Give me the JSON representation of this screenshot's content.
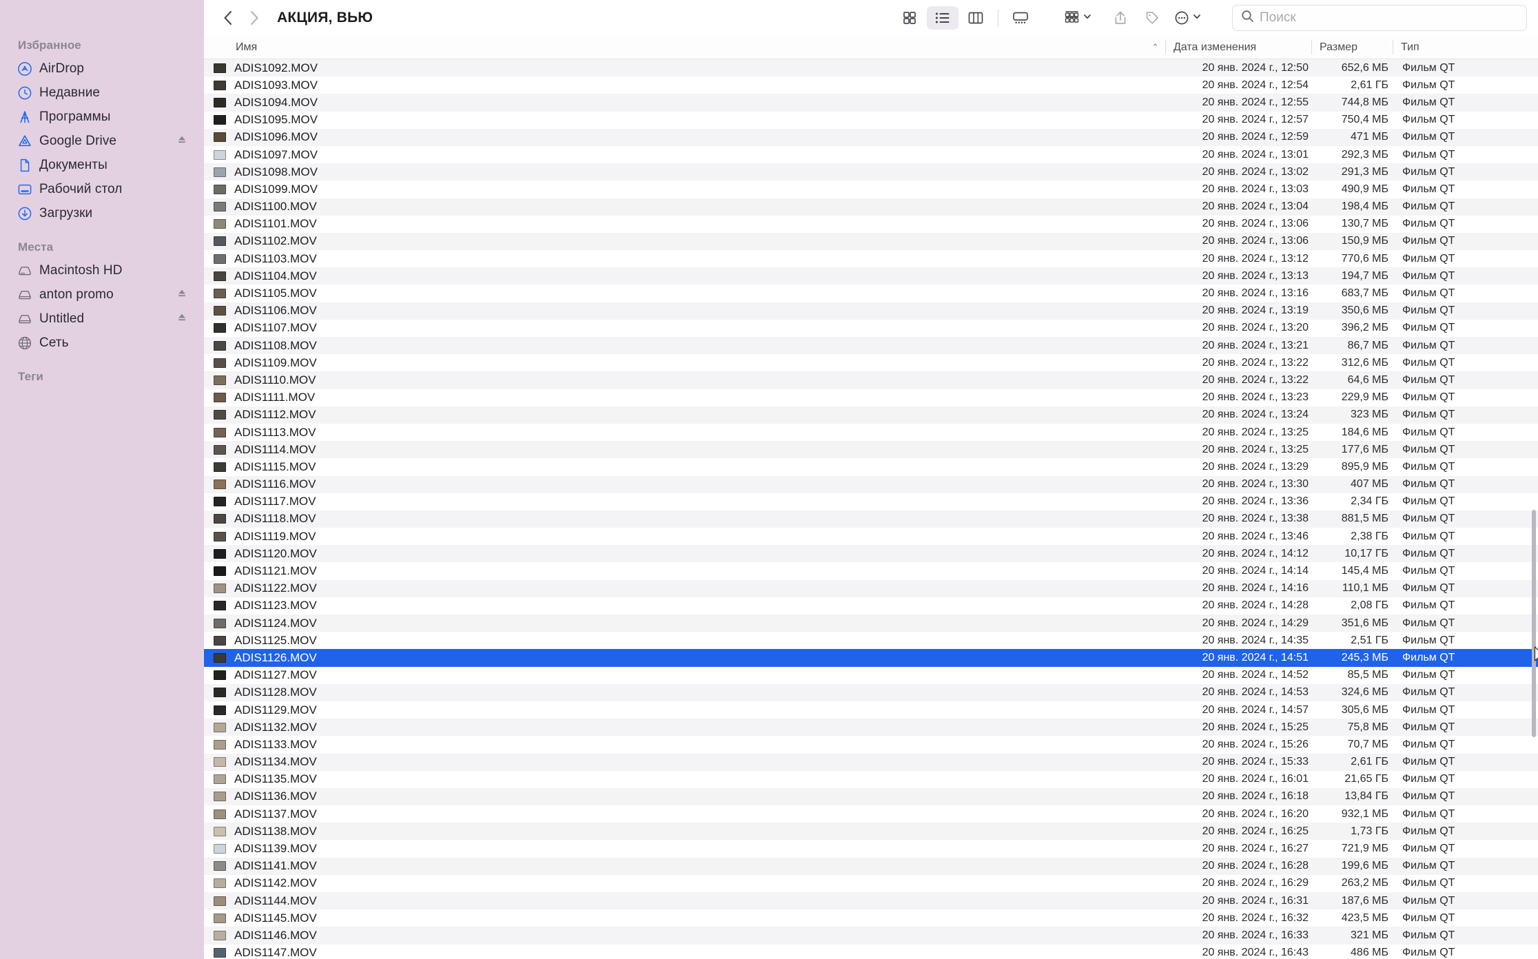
{
  "window": {
    "title": "АКЦИЯ, ВЬЮ",
    "back_label": "Назад",
    "forward_label": "Вперёд"
  },
  "search": {
    "placeholder": "Поиск"
  },
  "toolbar": {
    "icons": [
      {
        "name": "icon-view-button",
        "label": "Вид значками"
      },
      {
        "name": "list-view-button",
        "label": "Вид списком"
      },
      {
        "name": "column-view-button",
        "label": "Вид колонками"
      },
      {
        "name": "gallery-view-button",
        "label": "Вид галереей"
      },
      {
        "name": "group-by-button",
        "label": "Группировать"
      },
      {
        "name": "share-button",
        "label": "Поделиться"
      },
      {
        "name": "tags-button",
        "label": "Теги"
      },
      {
        "name": "more-actions-button",
        "label": "Ещё"
      }
    ]
  },
  "sidebar": {
    "groups": [
      {
        "title": "Избранное",
        "items": [
          {
            "label": "AirDrop",
            "icon": "airdrop-icon",
            "eject": false
          },
          {
            "label": "Недавние",
            "icon": "clock-icon",
            "eject": false
          },
          {
            "label": "Программы",
            "icon": "applications-icon",
            "eject": false
          },
          {
            "label": "Google Drive",
            "icon": "google-drive-icon",
            "eject": true
          },
          {
            "label": "Документы",
            "icon": "document-icon",
            "eject": false
          },
          {
            "label": "Рабочий стол",
            "icon": "desktop-icon",
            "eject": false
          },
          {
            "label": "Загрузки",
            "icon": "downloads-icon",
            "eject": false
          }
        ]
      },
      {
        "title": "Места",
        "items": [
          {
            "label": "Macintosh HD",
            "icon": "internal-drive-icon",
            "eject": false
          },
          {
            "label": "anton promo",
            "icon": "external-drive-icon",
            "eject": true
          },
          {
            "label": "Untitled",
            "icon": "external-drive-icon",
            "eject": true
          },
          {
            "label": "Сеть",
            "icon": "network-icon",
            "eject": false
          }
        ]
      },
      {
        "title": "Теги",
        "items": []
      }
    ]
  },
  "columns": {
    "name": "Имя",
    "date": "Дата изменения",
    "size": "Размер",
    "type": "Тип",
    "sort_caret": "⌃"
  },
  "files": [
    {
      "name": "ADIS1092.MOV",
      "date": "20 янв. 2024 г., 12:50",
      "size": "652,6 МБ",
      "type": "Фильм QT",
      "tint": "#3a3630"
    },
    {
      "name": "ADIS1093.MOV",
      "date": "20 янв. 2024 г., 12:54",
      "size": "2,61 ГБ",
      "type": "Фильм QT",
      "tint": "#3f3a33"
    },
    {
      "name": "ADIS1094.MOV",
      "date": "20 янв. 2024 г., 12:55",
      "size": "744,8 МБ",
      "type": "Фильм QT",
      "tint": "#2e2a26"
    },
    {
      "name": "ADIS1095.MOV",
      "date": "20 янв. 2024 г., 12:57",
      "size": "750,4 МБ",
      "type": "Фильм QT",
      "tint": "#232022"
    },
    {
      "name": "ADIS1096.MOV",
      "date": "20 янв. 2024 г., 12:59",
      "size": "471 МБ",
      "type": "Фильм QT",
      "tint": "#5a4a38"
    },
    {
      "name": "ADIS1097.MOV",
      "date": "20 янв. 2024 г., 13:01",
      "size": "292,3 МБ",
      "type": "Фильм QT",
      "tint": "#cfd3da"
    },
    {
      "name": "ADIS1098.MOV",
      "date": "20 янв. 2024 г., 13:02",
      "size": "291,3 МБ",
      "type": "Фильм QT",
      "tint": "#9aa4ad"
    },
    {
      "name": "ADIS1099.MOV",
      "date": "20 янв. 2024 г., 13:03",
      "size": "490,9 МБ",
      "type": "Фильм QT",
      "tint": "#6e6a66"
    },
    {
      "name": "ADIS1100.MOV",
      "date": "20 янв. 2024 г., 13:04",
      "size": "198,4 МБ",
      "type": "Фильм QT",
      "tint": "#7c7a78"
    },
    {
      "name": "ADIS1101.MOV",
      "date": "20 янв. 2024 г., 13:06",
      "size": "130,7 МБ",
      "type": "Фильм QT",
      "tint": "#8d8a77"
    },
    {
      "name": "ADIS1102.MOV",
      "date": "20 янв. 2024 г., 13:06",
      "size": "150,9 МБ",
      "type": "Фильм QT",
      "tint": "#55585c"
    },
    {
      "name": "ADIS1103.MOV",
      "date": "20 янв. 2024 г., 13:12",
      "size": "770,6 МБ",
      "type": "Фильм QT",
      "tint": "#6d6f72"
    },
    {
      "name": "ADIS1104.MOV",
      "date": "20 янв. 2024 г., 13:13",
      "size": "194,7 МБ",
      "type": "Фильм QT",
      "tint": "#4a4440"
    },
    {
      "name": "ADIS1105.MOV",
      "date": "20 янв. 2024 г., 13:16",
      "size": "683,7 МБ",
      "type": "Фильм QT",
      "tint": "#6a5f52"
    },
    {
      "name": "ADIS1106.MOV",
      "date": "20 янв. 2024 г., 13:19",
      "size": "350,6 МБ",
      "type": "Фильм QT",
      "tint": "#5f5245"
    },
    {
      "name": "ADIS1107.MOV",
      "date": "20 янв. 2024 г., 13:20",
      "size": "396,2 МБ",
      "type": "Фильм QT",
      "tint": "#33312f"
    },
    {
      "name": "ADIS1108.MOV",
      "date": "20 янв. 2024 г., 13:21",
      "size": "86,7 МБ",
      "type": "Фильм QT",
      "tint": "#4b4743"
    },
    {
      "name": "ADIS1109.MOV",
      "date": "20 янв. 2024 г., 13:22",
      "size": "312,6 МБ",
      "type": "Фильм QT",
      "tint": "#585049"
    },
    {
      "name": "ADIS1110.MOV",
      "date": "20 янв. 2024 г., 13:22",
      "size": "64,6 МБ",
      "type": "Фильм QT",
      "tint": "#7d6e5d"
    },
    {
      "name": "ADIS1111.MOV",
      "date": "20 янв. 2024 г., 13:23",
      "size": "229,9 МБ",
      "type": "Фильм QT",
      "tint": "#6b5c4d"
    },
    {
      "name": "ADIS1112.MOV",
      "date": "20 янв. 2024 г., 13:24",
      "size": "323 МБ",
      "type": "Фильм QT",
      "tint": "#4f4a45"
    },
    {
      "name": "ADIS1113.MOV",
      "date": "20 янв. 2024 г., 13:25",
      "size": "184,6 МБ",
      "type": "Фильм QT",
      "tint": "#726356"
    },
    {
      "name": "ADIS1114.MOV",
      "date": "20 янв. 2024 г., 13:25",
      "size": "177,6 МБ",
      "type": "Фильм QT",
      "tint": "#5d564f"
    },
    {
      "name": "ADIS1115.MOV",
      "date": "20 янв. 2024 г., 13:29",
      "size": "895,9 МБ",
      "type": "Фильм QT",
      "tint": "#3e3a36"
    },
    {
      "name": "ADIS1116.MOV",
      "date": "20 янв. 2024 г., 13:30",
      "size": "407 МБ",
      "type": "Фильм QT",
      "tint": "#8a7258"
    },
    {
      "name": "ADIS1117.MOV",
      "date": "20 янв. 2024 г., 13:36",
      "size": "2,34 ГБ",
      "type": "Фильм QT",
      "tint": "#262426"
    },
    {
      "name": "ADIS1118.MOV",
      "date": "20 янв. 2024 г., 13:38",
      "size": "881,5 МБ",
      "type": "Фильм QT",
      "tint": "#4c4744"
    },
    {
      "name": "ADIS1119.MOV",
      "date": "20 янв. 2024 г., 13:46",
      "size": "2,38 ГБ",
      "type": "Фильм QT",
      "tint": "#59514a"
    },
    {
      "name": "ADIS1120.MOV",
      "date": "20 янв. 2024 г., 14:12",
      "size": "10,17 ГБ",
      "type": "Фильм QT",
      "tint": "#1f1d1f"
    },
    {
      "name": "ADIS1121.MOV",
      "date": "20 янв. 2024 г., 14:14",
      "size": "145,4 МБ",
      "type": "Фильм QT",
      "tint": "#1b1a1c"
    },
    {
      "name": "ADIS1122.MOV",
      "date": "20 янв. 2024 г., 14:16",
      "size": "110,1 МБ",
      "type": "Фильм QT",
      "tint": "#9d9386"
    },
    {
      "name": "ADIS1123.MOV",
      "date": "20 янв. 2024 г., 14:28",
      "size": "2,08 ГБ",
      "type": "Фильм QT",
      "tint": "#2a2729"
    },
    {
      "name": "ADIS1124.MOV",
      "date": "20 янв. 2024 г., 14:29",
      "size": "351,6 МБ",
      "type": "Фильм QT",
      "tint": "#6f6c68"
    },
    {
      "name": "ADIS1125.MOV",
      "date": "20 янв. 2024 г., 14:35",
      "size": "2,51 ГБ",
      "type": "Фильм QT",
      "tint": "#4a4643"
    },
    {
      "name": "ADIS1126.MOV",
      "date": "20 янв. 2024 г., 14:51",
      "size": "245,3 МБ",
      "type": "Фильм QT",
      "tint": "#3b3836",
      "selected": true
    },
    {
      "name": "ADIS1127.MOV",
      "date": "20 янв. 2024 г., 14:52",
      "size": "85,5 МБ",
      "type": "Фильм QT",
      "tint": "#23211f"
    },
    {
      "name": "ADIS1128.MOV",
      "date": "20 янв. 2024 г., 14:53",
      "size": "324,6 МБ",
      "type": "Фильм QT",
      "tint": "#2b2927"
    },
    {
      "name": "ADIS1129.MOV",
      "date": "20 янв. 2024 г., 14:57",
      "size": "305,6 МБ",
      "type": "Фильм QT",
      "tint": "#29282a"
    },
    {
      "name": "ADIS1132.MOV",
      "date": "20 янв. 2024 г., 15:25",
      "size": "75,8 МБ",
      "type": "Фильм QT",
      "tint": "#b3a896"
    },
    {
      "name": "ADIS1133.MOV",
      "date": "20 янв. 2024 г., 15:26",
      "size": "70,7 МБ",
      "type": "Фильм QT",
      "tint": "#a99d8c"
    },
    {
      "name": "ADIS1134.MOV",
      "date": "20 янв. 2024 г., 15:33",
      "size": "2,61 ГБ",
      "type": "Фильм QT",
      "tint": "#c3b8a6"
    },
    {
      "name": "ADIS1135.MOV",
      "date": "20 янв. 2024 г., 16:01",
      "size": "21,65 ГБ",
      "type": "Фильм QT",
      "tint": "#b0a594"
    },
    {
      "name": "ADIS1136.MOV",
      "date": "20 янв. 2024 г., 16:18",
      "size": "13,84 ГБ",
      "type": "Фильм QT",
      "tint": "#a89d8d"
    },
    {
      "name": "ADIS1137.MOV",
      "date": "20 янв. 2024 г., 16:20",
      "size": "932,1 МБ",
      "type": "Фильм QT",
      "tint": "#9c9181"
    },
    {
      "name": "ADIS1138.MOV",
      "date": "20 янв. 2024 г., 16:25",
      "size": "1,73 ГБ",
      "type": "Фильм QT",
      "tint": "#c8bfb0"
    },
    {
      "name": "ADIS1139.MOV",
      "date": "20 янв. 2024 г., 16:27",
      "size": "721,9 МБ",
      "type": "Фильм QT",
      "tint": "#cdd4dc"
    },
    {
      "name": "ADIS1141.MOV",
      "date": "20 янв. 2024 г., 16:28",
      "size": "199,6 МБ",
      "type": "Фильм QT",
      "tint": "#8d8b86"
    },
    {
      "name": "ADIS1142.MOV",
      "date": "20 янв. 2024 г., 16:29",
      "size": "263,2 МБ",
      "type": "Фильм QT",
      "tint": "#b6ada0"
    },
    {
      "name": "ADIS1144.MOV",
      "date": "20 янв. 2024 г., 16:31",
      "size": "187,6 МБ",
      "type": "Фильм QT",
      "tint": "#9a8d7e"
    },
    {
      "name": "ADIS1145.MOV",
      "date": "20 янв. 2024 г., 16:32",
      "size": "423,5 МБ",
      "type": "Фильм QT",
      "tint": "#a59a8b"
    },
    {
      "name": "ADIS1146.MOV",
      "date": "20 янв. 2024 г., 16:33",
      "size": "321 МБ",
      "type": "Фильм QT",
      "tint": "#b9aea0"
    },
    {
      "name": "ADIS1147.MOV",
      "date": "20 янв. 2024 г., 16:43",
      "size": "486 МБ",
      "type": "Фильм QT",
      "tint": "#56636f"
    }
  ],
  "colors": {
    "sidebar_bg": "#e3d1e2",
    "selection": "#1f63e8",
    "accent_icon": "#1e6bf0"
  }
}
